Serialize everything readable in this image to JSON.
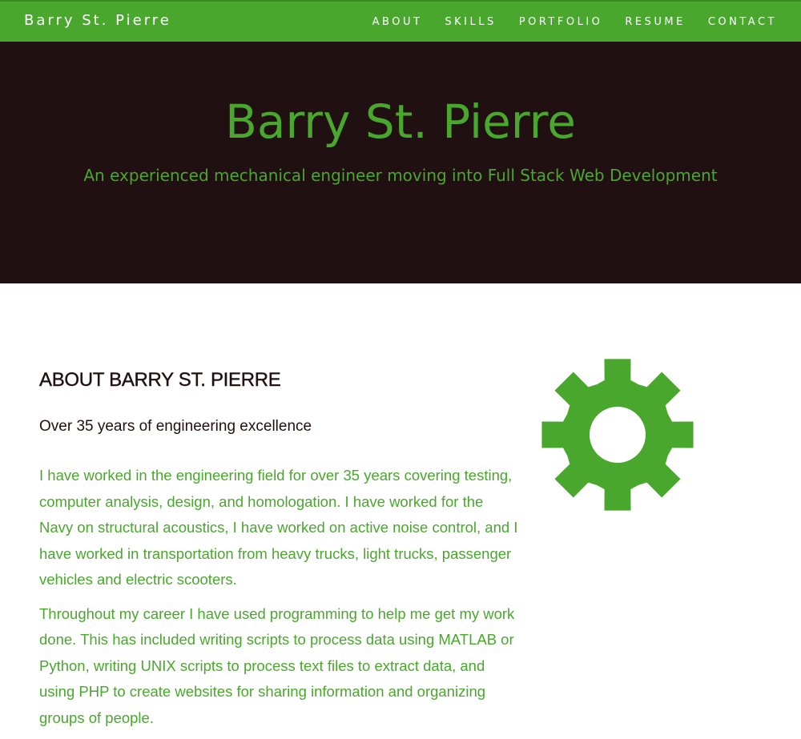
{
  "nav": {
    "brand": "Barry St. Pierre",
    "links": [
      "ABOUT",
      "SKILLS",
      "PORTFOLIO",
      "RESUME",
      "CONTACT"
    ]
  },
  "hero": {
    "title": "Barry St. Pierre",
    "subtitle": "An experienced mechanical engineer moving into Full Stack Web Development"
  },
  "about": {
    "heading": "ABOUT BARRY ST. PIERRE",
    "tagline": "Over 35 years of engineering excellence",
    "paragraphs": [
      "I have worked in the engineering field for over 35 years covering testing, computer analysis, design, and homologation. I have worked for the Navy on structural acoustics, I have worked on active noise control, and I have worked in transportation from heavy trucks, light trucks, passenger vehicles and electric scooters.",
      "Throughout my career I have used programming to help me get my work done. This has included writing scripts to process data using MATLAB or Python, writing UNIX scripts to process text files to extract data, and using PHP to create websites for sharing information and organizing groups of people."
    ],
    "icon": "gear-icon"
  },
  "colors": {
    "accent": "#4aa72e",
    "hero_bg": "#201011",
    "heading": "#201011"
  }
}
